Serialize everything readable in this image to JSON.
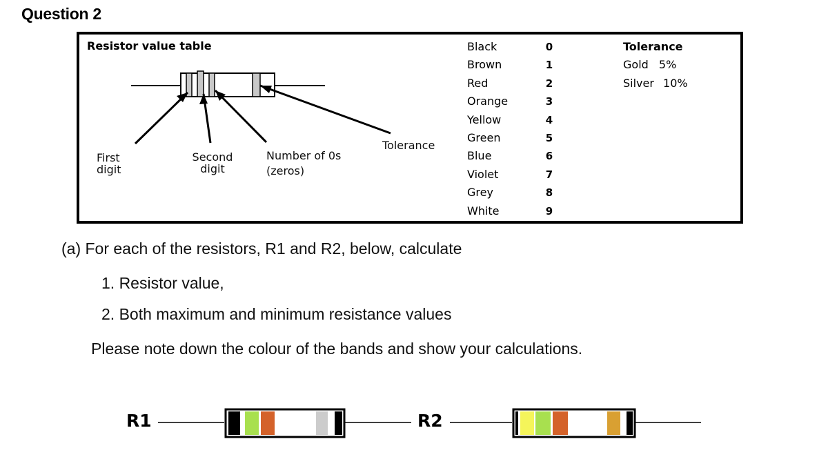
{
  "question": {
    "title": "Question 2"
  },
  "resistor_table": {
    "heading": "Resistor value table",
    "band_labels": {
      "first_digit": [
        "First",
        "digit"
      ],
      "second_digit": [
        "Second",
        "digit"
      ],
      "number_of_zeros": [
        "Number of 0s",
        "(zeros)"
      ],
      "tolerance": "Tolerance"
    },
    "color_codes": [
      {
        "name": "Black",
        "value": "0"
      },
      {
        "name": "Brown",
        "value": "1"
      },
      {
        "name": "Red",
        "value": "2"
      },
      {
        "name": "Orange",
        "value": "3"
      },
      {
        "name": "Yellow",
        "value": "4"
      },
      {
        "name": "Green",
        "value": "5"
      },
      {
        "name": "Blue",
        "value": "6"
      },
      {
        "name": "Violet",
        "value": "7"
      },
      {
        "name": "Grey",
        "value": "8"
      },
      {
        "name": "White",
        "value": "9"
      }
    ],
    "tolerance": {
      "heading": "Tolerance",
      "rows": [
        {
          "name": "Gold",
          "value": "5%"
        },
        {
          "name": "Silver",
          "value": "10%"
        }
      ]
    }
  },
  "instructions": {
    "part_a": "(a) For each of the resistors, R1 and R2, below, calculate",
    "items": [
      "1. Resistor value,",
      "2. Both maximum and minimum resistance values"
    ],
    "note": "Please note down the colour of the bands and show your calculations."
  },
  "resistors": [
    {
      "label": "R1",
      "bands": [
        {
          "role": "first",
          "color": "#a8e04f"
        },
        {
          "role": "second",
          "color": "#d4622a"
        },
        {
          "role": "tolerance",
          "color": "#cccccc"
        }
      ]
    },
    {
      "label": "R2",
      "bands": [
        {
          "role": "first",
          "color": "#f5f55a"
        },
        {
          "role": "second",
          "color": "#a8e04f"
        },
        {
          "role": "multiplier",
          "color": "#d4622a"
        },
        {
          "role": "tolerance",
          "color": "#d9a032"
        }
      ]
    }
  ],
  "diagram": {
    "band_fill": "#c8c8c8"
  }
}
